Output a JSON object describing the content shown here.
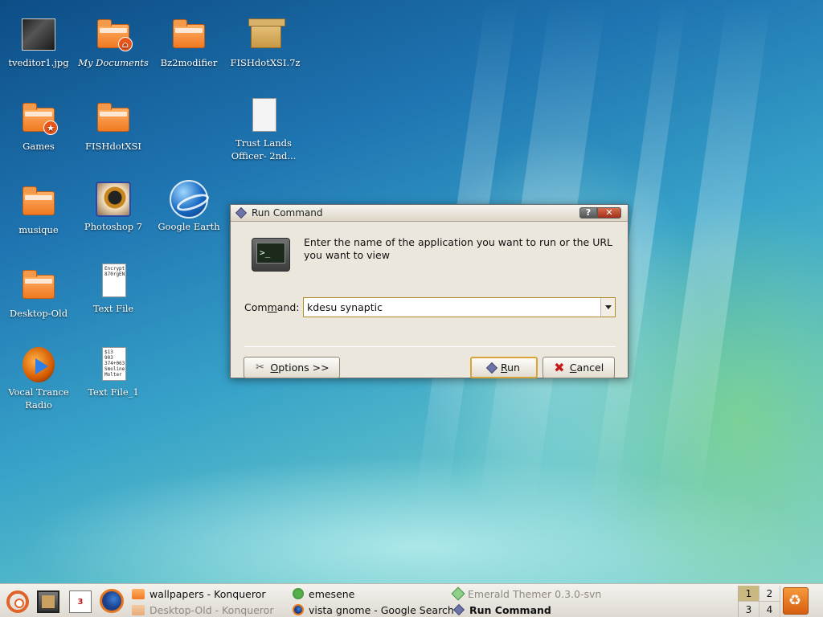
{
  "desktop": {
    "icons": [
      {
        "label": "tveditor1.jpg"
      },
      {
        "label": "My Documents"
      },
      {
        "label": "Bz2modifier"
      },
      {
        "label": "FISHdotXSI.7z"
      },
      {
        "label": "Games"
      },
      {
        "label": "FISHdotXSI"
      },
      {
        "label": "Trust Lands Officer- 2nd..."
      },
      {
        "label": "musique"
      },
      {
        "label": "Photoshop 7"
      },
      {
        "label": "Google Earth"
      },
      {
        "label": "Desktop-Old"
      },
      {
        "label": "Text File"
      },
      {
        "label": "Vocal Trance Radio"
      },
      {
        "label": "Text File_1"
      }
    ],
    "text_file_preview": "Encrypt 870rgEN",
    "text_file1_preview": "$13 903 374+063 Smoline Molter"
  },
  "dialog": {
    "title": "Run Command",
    "help_label": "?",
    "close_label": "✕",
    "terminal_glyph": ">_",
    "message": "Enter the name of the application you want to run or the URL you want to view",
    "command_label_pre": "Com",
    "command_label_accel": "m",
    "command_label_post": "and:",
    "command_value": "kdesu synaptic",
    "options_accel": "O",
    "options_rest": "ptions >>",
    "run_accel": "R",
    "run_rest": "un",
    "cancel_accel": "C",
    "cancel_rest": "ancel"
  },
  "taskbar": {
    "calendar_day": "3",
    "tasks": [
      {
        "label": "wallpapers - Konqueror"
      },
      {
        "label": "Desktop-Old - Konqueror"
      },
      {
        "label": "emesene"
      },
      {
        "label": "vista gnome - Google Search"
      },
      {
        "label": "Emerald Themer 0.3.0-svn"
      },
      {
        "label": "Run Command"
      }
    ],
    "pager": [
      "1",
      "2",
      "3",
      "4"
    ]
  }
}
